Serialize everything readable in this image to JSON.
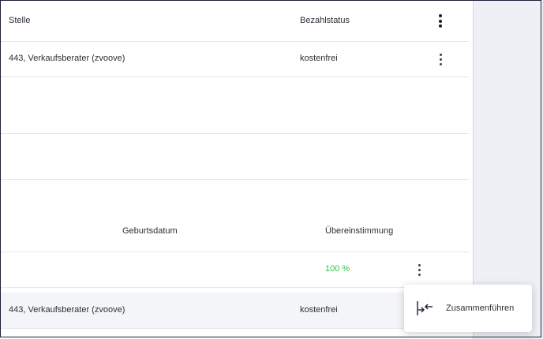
{
  "table_top": {
    "headers": {
      "position": "Stelle",
      "payment_status": "Bezahlstatus"
    },
    "rows": [
      {
        "position": "443, Verkaufsberater (zvoove)",
        "payment_status": "kostenfrei"
      }
    ]
  },
  "table_match": {
    "headers": {
      "birth_date": "Geburtsdatum",
      "match": "Übereinstimmung"
    },
    "rows": [
      {
        "match": "100 %"
      }
    ]
  },
  "table_bottom": {
    "rows": [
      {
        "position": "443, Verkaufsberater (zvoove)",
        "payment_status": "kostenfrei"
      }
    ]
  },
  "context_menu": {
    "items": [
      {
        "label": "Zusammenführen",
        "icon": "merge-icon"
      }
    ]
  },
  "colors": {
    "match_green": "#35c24b",
    "text": "#2b2f36",
    "side_bg": "#eef0f5"
  }
}
